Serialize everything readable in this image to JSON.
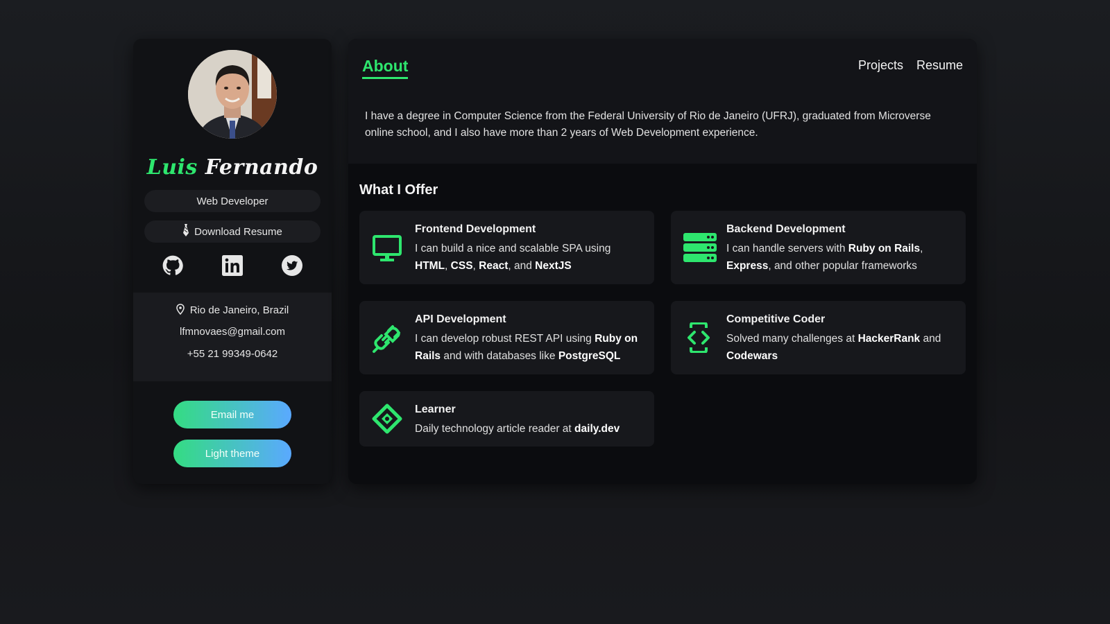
{
  "profile": {
    "first_name": "Luis",
    "last_name": "Fernando",
    "role": "Web Developer",
    "download_label": "Download Resume",
    "location": "Rio de Janeiro, Brazil",
    "email": "lfmnovaes@gmail.com",
    "phone": "+55 21 99349-0642",
    "socials": [
      "github-icon",
      "linkedin-icon",
      "twitter-icon"
    ]
  },
  "buttons": {
    "email_me": "Email me",
    "light_theme": "Light theme"
  },
  "nav": {
    "about": "About",
    "projects": "Projects",
    "resume": "Resume"
  },
  "about": {
    "text": "I have a degree in Computer Science from the Federal University of Rio de Janeiro (UFRJ), graduated from Microverse online school, and I also have more than 2 years of Web Development experience."
  },
  "offer": {
    "title": "What I Offer",
    "cards": [
      {
        "icon": "monitor-icon",
        "title": "Frontend Development",
        "desc": [
          {
            "t": "I can build a nice and scalable SPA using "
          },
          {
            "t": "HTML",
            "b": true
          },
          {
            "t": ", "
          },
          {
            "t": "CSS",
            "b": true
          },
          {
            "t": ", "
          },
          {
            "t": "React",
            "b": true
          },
          {
            "t": ", and "
          },
          {
            "t": "NextJS",
            "b": true
          }
        ]
      },
      {
        "icon": "server-icon",
        "title": "Backend Development",
        "desc": [
          {
            "t": "I can handle servers with "
          },
          {
            "t": "Ruby on Rails",
            "b": true
          },
          {
            "t": ", "
          },
          {
            "t": "Express",
            "b": true
          },
          {
            "t": ", and other popular frameworks"
          }
        ]
      },
      {
        "icon": "plug-icon",
        "title": "API Development",
        "desc": [
          {
            "t": "I can develop robust REST API using "
          },
          {
            "t": "Ruby on Rails",
            "b": true
          },
          {
            "t": " and with databases like "
          },
          {
            "t": "PostgreSQL",
            "b": true
          }
        ]
      },
      {
        "icon": "code-phone-icon",
        "title": "Competitive Coder",
        "desc": [
          {
            "t": "Solved many challenges at "
          },
          {
            "t": "HackerRank",
            "b": true
          },
          {
            "t": " and "
          },
          {
            "t": "Codewars",
            "b": true
          }
        ]
      },
      {
        "icon": "diamond-eye-icon",
        "title": "Learner",
        "desc": [
          {
            "t": "Daily technology article reader at "
          },
          {
            "t": "daily.dev",
            "b": true
          }
        ]
      }
    ]
  },
  "colors": {
    "accent": "#2ee66e",
    "card_bg": "#17181c",
    "gradient_start": "#34dc82",
    "gradient_end": "#5aa9ff"
  }
}
